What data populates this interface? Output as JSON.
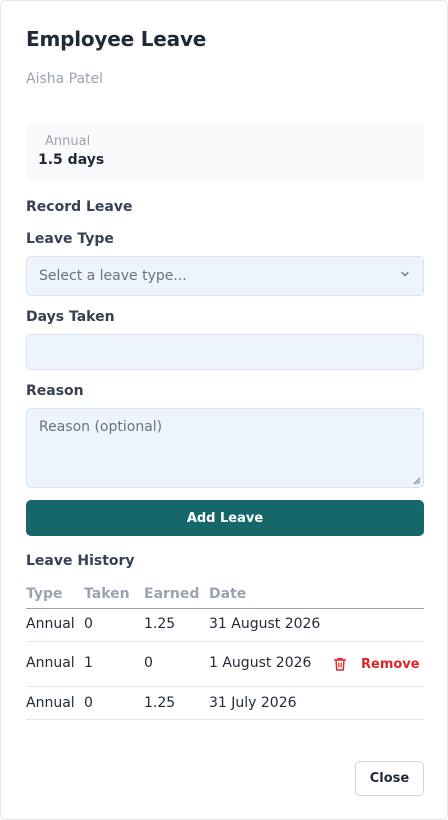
{
  "dialog": {
    "title": "Employee Leave",
    "employee_name": "Aisha Patel"
  },
  "balance": {
    "label": "Annual",
    "value": "1.5 days"
  },
  "record_form": {
    "section_title": "Record Leave",
    "leave_type_label": "Leave Type",
    "leave_type_placeholder": "Select a leave type...",
    "days_taken_label": "Days Taken",
    "days_taken_value": "",
    "reason_label": "Reason",
    "reason_placeholder": "Reason (optional)",
    "submit_label": "Add Leave"
  },
  "history": {
    "section_title": "Leave History",
    "columns": [
      "Type",
      "Taken",
      "Earned",
      "Date"
    ],
    "rows": [
      {
        "type": "Annual",
        "taken": "0",
        "earned": "1.25",
        "date": "31 August 2026",
        "action": ""
      },
      {
        "type": "Annual",
        "taken": "1",
        "earned": "0",
        "date": "1 August 2026",
        "action": "Remove"
      },
      {
        "type": "Annual",
        "taken": "0",
        "earned": "1.25",
        "date": "31 July 2026",
        "action": ""
      }
    ]
  },
  "footer": {
    "close_label": "Close"
  },
  "colors": {
    "primary": "#16676a",
    "danger": "#dc2626",
    "field_bg": "#eef4fb"
  },
  "icons": {
    "select_chevron": "chevron-down-icon",
    "remove": "trash-icon",
    "resize": "resize-handle-icon"
  }
}
